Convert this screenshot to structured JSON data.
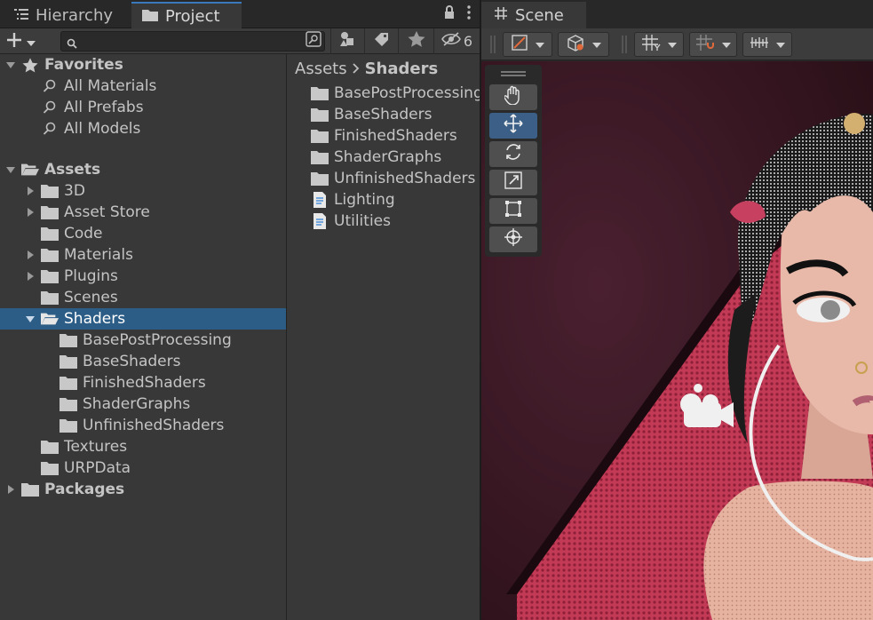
{
  "left_window": {
    "tabs": [
      {
        "label": "Hierarchy",
        "icon": "hierarchy-icon"
      },
      {
        "label": "Project",
        "icon": "folder-icon"
      }
    ],
    "toolbar": {
      "add_icon": "plus-icon",
      "search_placeholder": "",
      "hidden_count": "6"
    },
    "tree": {
      "favorites_label": "Favorites",
      "favorites": [
        "All Materials",
        "All Prefabs",
        "All Models"
      ],
      "assets_label": "Assets",
      "assets_children": [
        "3D",
        "Asset Store",
        "Code",
        "Materials",
        "Plugins",
        "Scenes",
        "Shaders",
        "Textures",
        "URPData"
      ],
      "shaders_children": [
        "BasePostProcessing",
        "BaseShaders",
        "FinishedShaders",
        "ShaderGraphs",
        "UnfinishedShaders"
      ],
      "packages_label": "Packages",
      "selected": "Shaders"
    },
    "contents": {
      "breadcrumb": [
        "Assets",
        "Shaders"
      ],
      "items": [
        {
          "label": "BasePostProcessing",
          "type": "folder"
        },
        {
          "label": "BaseShaders",
          "type": "folder"
        },
        {
          "label": "FinishedShaders",
          "type": "folder"
        },
        {
          "label": "ShaderGraphs",
          "type": "folder"
        },
        {
          "label": "UnfinishedShaders",
          "type": "folder"
        },
        {
          "label": "Lighting",
          "type": "script"
        },
        {
          "label": "Utilities",
          "type": "script"
        }
      ]
    }
  },
  "scene_window": {
    "tab_label": "Scene",
    "tab_icon": "hash-icon",
    "tools": [
      "hand-tool",
      "move-tool",
      "rotate-tool",
      "scale-tool",
      "rect-tool",
      "transform-tool"
    ],
    "active_tool": "move-tool"
  },
  "colors": {
    "selection": "#2c5d87",
    "accent": "#3a79bb",
    "panel": "#383838",
    "dark": "#282828"
  }
}
